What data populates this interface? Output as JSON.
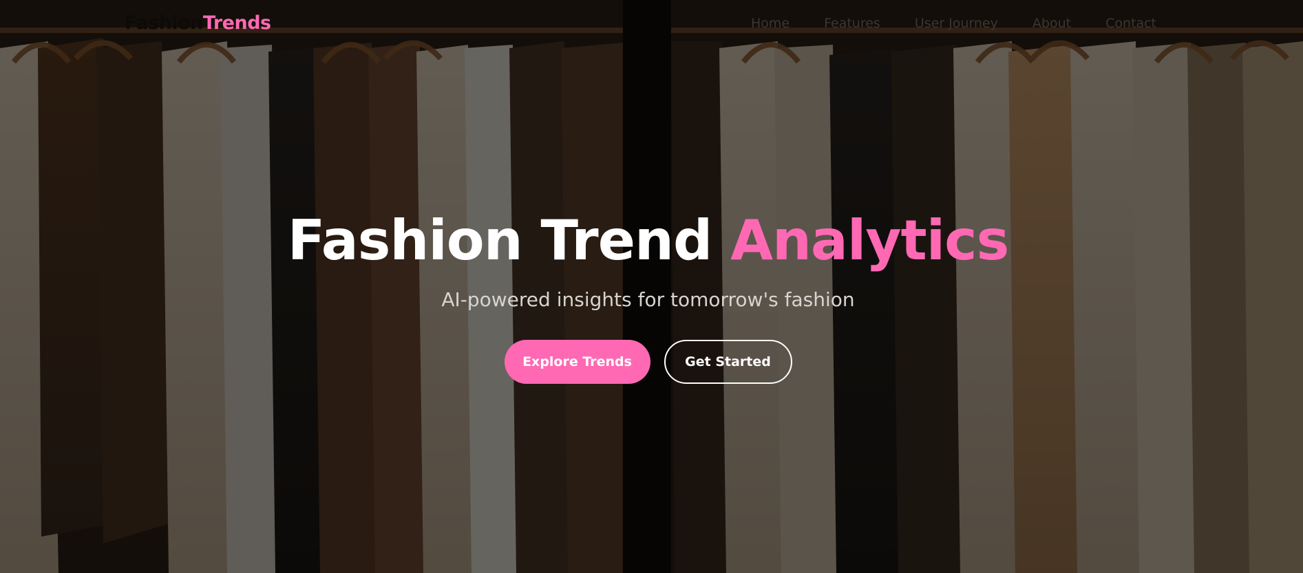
{
  "brand": {
    "logo_part1": "Fashion",
    "logo_part2": "Trends",
    "accent_color": "#ff69b4"
  },
  "nav": {
    "items": [
      {
        "label": "Home"
      },
      {
        "label": "Features"
      },
      {
        "label": "User Journey"
      },
      {
        "label": "About"
      },
      {
        "label": "Contact"
      }
    ]
  },
  "hero": {
    "title_main": "Fashion Trend ",
    "title_accent": "Analytics",
    "subtitle": "AI-powered insights for tomorrow's fashion",
    "primary_button": "Explore Trends",
    "secondary_button": "Get Started"
  }
}
